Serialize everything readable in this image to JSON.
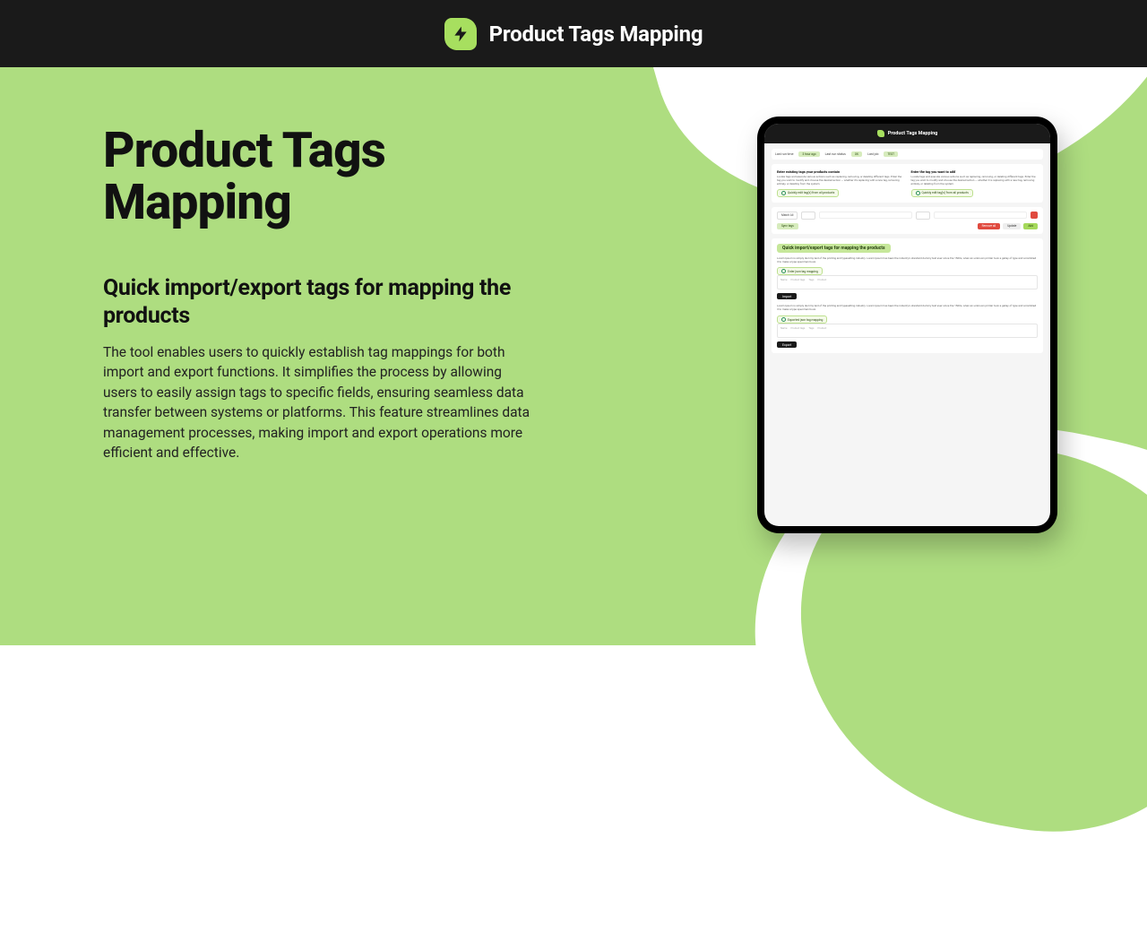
{
  "topbar": {
    "title": "Product Tags Mapping"
  },
  "hero": {
    "title": "Product Tags Mapping",
    "subtitle": "Quick import/export tags for mapping the products",
    "body": "The tool enables users to quickly establish tag mappings for both import and export functions. It simplifies the process by allowing users to easily assign tags to specific fields, ensuring seamless data transfer between systems or platforms. This feature streamlines data management processes, making import and export operations more efficient and effective."
  },
  "tablet": {
    "topbar_title": "Product Tags Mapping",
    "status": {
      "last_run_time_label": "Last run time",
      "last_run_time_value": "3 hour ago",
      "last_run_status_label": "Last run status",
      "last_run_status_value": "OK",
      "last_job_label": "Last job",
      "last_job_value": "TEST"
    },
    "columns": {
      "left": {
        "heading": "Enter existing tags your products contain",
        "desc": "Locate tags and execute various actions such as replacing, removing, or deleting different tags. Enter the tag you wish to modify and choose the desired action — whether it's replacing with a new tag, removing entirely, or deleting from the system.",
        "link": "Quickly edit tag(s) from all products"
      },
      "right": {
        "heading": "Enter the tag you want to add",
        "desc": "Locate tags and execute various actions such as replacing, removing, or deleting different tags. Enter the tag you wish to modify and choose the desired action — whether it is replacing with a new tag, removing entirely, or deleting from the system.",
        "link": "Quickly edit tag(s) from all products"
      }
    },
    "controls": {
      "match_all": "Match All",
      "sync": "Sync tags",
      "remove_all": "Remove all",
      "update": "Update",
      "add": "Add"
    },
    "import_section": {
      "title": "Quick import/export tags for mapping the products",
      "desc": "Lorem Ipsum is simply dummy text of the printing and typesetting industry. Lorem Ipsum has been the industry's standard dummy text ever since the 1500s, when an unknown printer took a galley of type and scrambled it to make a type specimen book.",
      "link": "Enter json tag mapping",
      "import_btn": "Import",
      "desc2": "Lorem Ipsum is simply dummy text of the printing and typesetting industry. Lorem Ipsum has been the industry's standard dummy text ever since the 1500s, when an unknown printer took a galley of type and scrambled it to make a type specimen book.",
      "link2": "Exported json tag mapping",
      "export_btn": "Export"
    }
  }
}
